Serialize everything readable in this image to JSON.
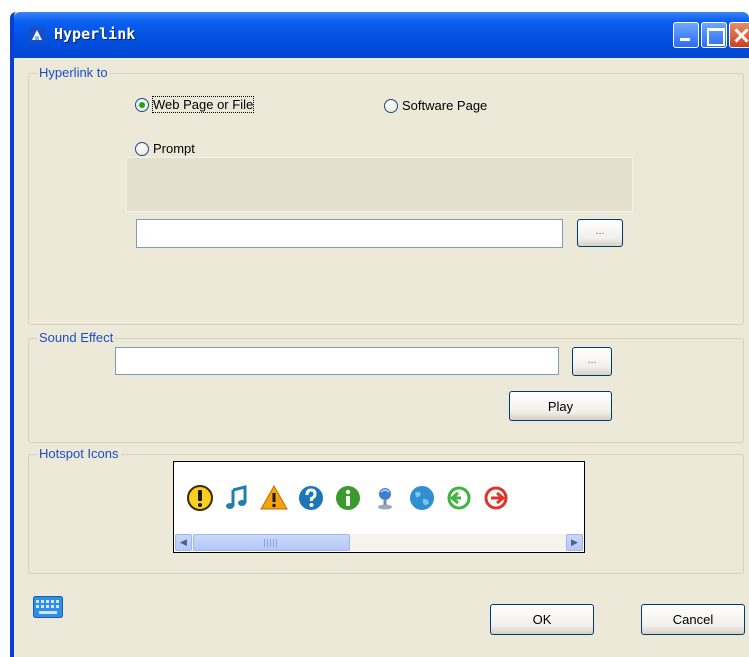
{
  "window": {
    "title": "Hyperlink",
    "buttons": {
      "minimize": "minimize",
      "maximize": "maximize",
      "close": "close"
    }
  },
  "hyperlink": {
    "group_label": "Hyperlink to",
    "options": [
      {
        "label": "Web Page or File",
        "checked": true
      },
      {
        "label": "Software Page",
        "checked": false
      },
      {
        "label": "Prompt",
        "checked": false
      }
    ],
    "path_value": "",
    "browse_label": "..."
  },
  "sound": {
    "group_label": "Sound Effect",
    "path_value": "",
    "browse_label": "...",
    "play_label": "Play"
  },
  "hotspot": {
    "group_label": "Hotspot Icons",
    "icons": [
      "exclamation-icon",
      "music-note-icon",
      "warning-icon",
      "question-icon",
      "info-icon",
      "microphone-icon",
      "globe-icon",
      "green-arrow-icon",
      "red-arrow-icon"
    ]
  },
  "footer": {
    "ok_label": "OK",
    "cancel_label": "Cancel"
  },
  "colors": {
    "title_bar": "#0250e0",
    "dialog_bg": "#ece9d8",
    "group_label": "#1d4cc8"
  }
}
